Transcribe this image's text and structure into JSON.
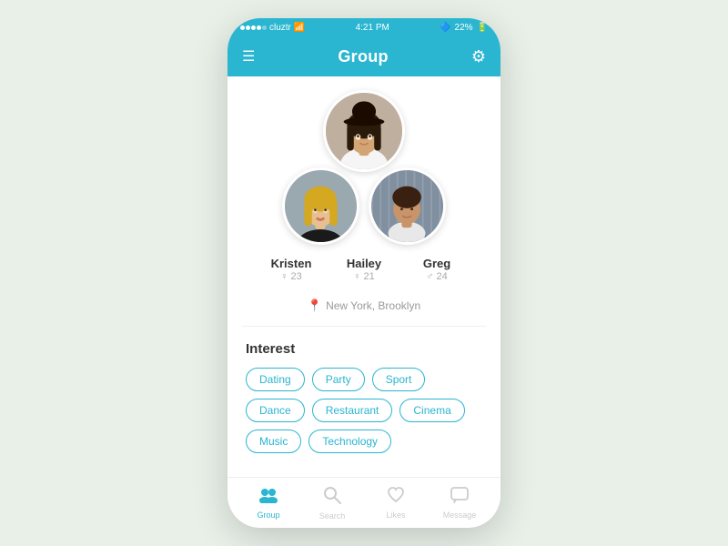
{
  "statusBar": {
    "carrier": "cluztr",
    "time": "4:21 PM",
    "battery": "22%"
  },
  "header": {
    "title": "Group",
    "menuIcon": "☰",
    "settingsIcon": "⚙"
  },
  "persons": [
    {
      "name": "Kristen",
      "age": "♀ 23",
      "position": "top"
    },
    {
      "name": "Hailey",
      "age": "♀ 21",
      "position": "bottom-left"
    },
    {
      "name": "Greg",
      "age": "♂ 24",
      "position": "bottom-right"
    }
  ],
  "location": "New York, Brooklyn",
  "interest": {
    "title": "Interest",
    "tags": [
      "Dating",
      "Party",
      "Sport",
      "Dance",
      "Restaurant",
      "Cinema",
      "Music",
      "Technology"
    ]
  },
  "bottomNav": [
    {
      "id": "group",
      "label": "Group",
      "icon": "group",
      "active": true
    },
    {
      "id": "search",
      "label": "Search",
      "icon": "search",
      "active": false
    },
    {
      "id": "likes",
      "label": "Likes",
      "icon": "likes",
      "active": false
    },
    {
      "id": "message",
      "label": "Message",
      "icon": "message",
      "active": false
    }
  ],
  "colors": {
    "primary": "#2ab5d1",
    "text": "#333",
    "muted": "#aaa"
  }
}
